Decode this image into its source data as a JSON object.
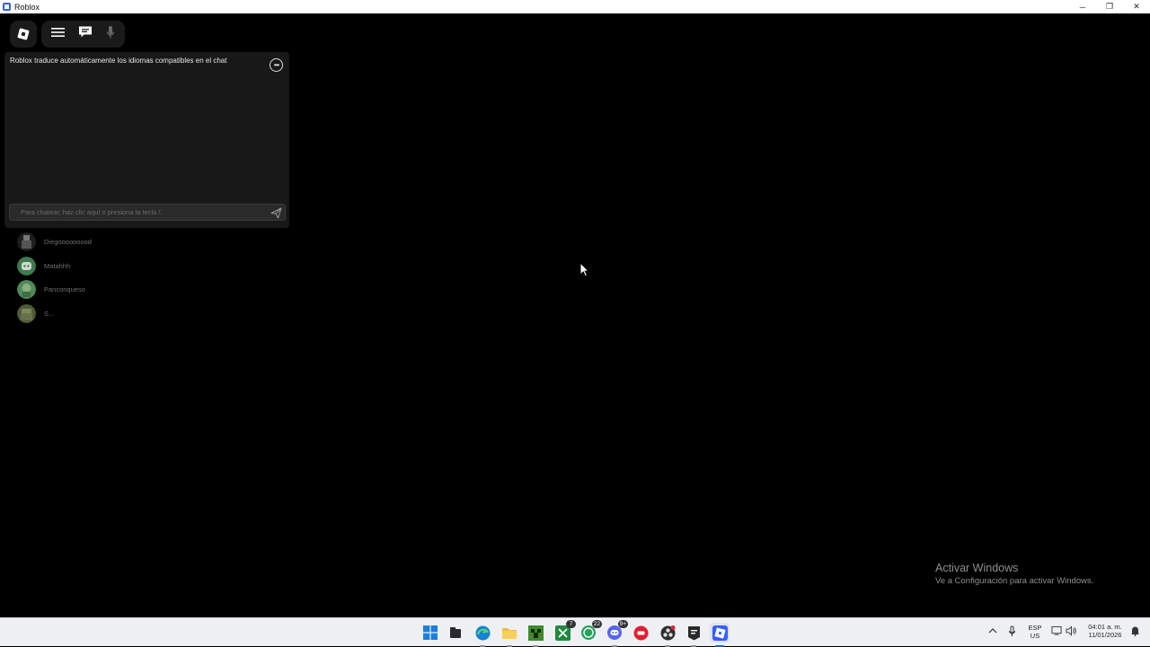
{
  "window": {
    "title": "Roblox",
    "minimize": "─",
    "maximize": "❐",
    "close": "✕"
  },
  "topbar": {
    "roblox_button": "roblox-logo-icon",
    "menu_button": "hamburger-menu-icon",
    "chat_button": "chat-bubble-icon",
    "mic_button": "microphone-icon"
  },
  "chat": {
    "system_message": "Roblox traduce automáticamente los idiomas compatibles en el chat",
    "more_options": "•••",
    "input_placeholder": "Para chatear, haz clic aquí o presiona la tecla /.",
    "send_icon": "send-icon"
  },
  "players": [
    {
      "name": "Diegooooooood",
      "avatar_color": "#5a5a5a"
    },
    {
      "name": "Matahhh",
      "avatar_color": "#4a8a5a"
    },
    {
      "name": "Panconqueso",
      "avatar_color": "#5a9a62"
    },
    {
      "name": "S...",
      "avatar_color": "#6c7a4a"
    }
  ],
  "activation": {
    "heading": "Activar Windows",
    "subtext": "Ve a Configuración para activar Windows."
  },
  "taskbar": {
    "apps": [
      {
        "name": "windows-start-icon",
        "badge": ""
      },
      {
        "name": "file-manager-icon",
        "badge": ""
      },
      {
        "name": "edge-browser-icon",
        "badge": ""
      },
      {
        "name": "file-explorer-icon",
        "badge": ""
      },
      {
        "name": "minecraft-icon",
        "badge": ""
      },
      {
        "name": "xbox-icon",
        "badge": "7"
      },
      {
        "name": "whatsapp-icon",
        "badge": "22"
      },
      {
        "name": "discord-icon",
        "badge": "9+"
      },
      {
        "name": "red-app-icon",
        "badge": ""
      },
      {
        "name": "obs-icon",
        "badge": ""
      },
      {
        "name": "epic-games-icon",
        "badge": ""
      },
      {
        "name": "roblox-app-icon",
        "badge": ""
      }
    ],
    "language_line1": "ESP",
    "language_line2": "US",
    "time": "04:01 a. m.",
    "date": "11/01/2026"
  },
  "colors": {
    "accent": "#1a64d6",
    "roblox_blue": "#335fff",
    "chat_bg": "#191919",
    "taskbar_bg": "#eef0f4"
  }
}
